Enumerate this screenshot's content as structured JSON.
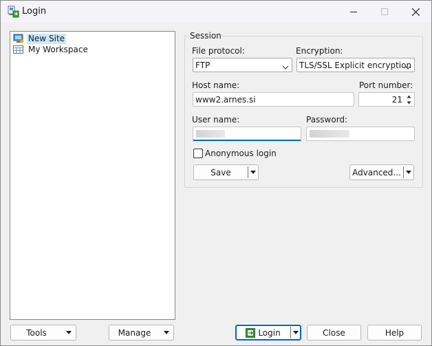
{
  "window": {
    "title": "Login"
  },
  "tree": {
    "items": [
      {
        "label": "New Site",
        "icon": "computer-icon",
        "selected": true
      },
      {
        "label": "My Workspace",
        "icon": "workspace-icon",
        "selected": false
      }
    ]
  },
  "session": {
    "legend": "Session",
    "file_protocol": {
      "label": "File protocol:",
      "value": "FTP"
    },
    "encryption": {
      "label": "Encryption:",
      "value": "TLS/SSL Explicit encryption"
    },
    "host": {
      "label": "Host name:",
      "value": "www2.arnes.si"
    },
    "port": {
      "label": "Port number:",
      "value": "21"
    },
    "user": {
      "label": "User name:",
      "value": ""
    },
    "password": {
      "label": "Password:",
      "value": ""
    },
    "anonymous": {
      "label": "Anonymous login",
      "checked": false
    },
    "save_label": "Save",
    "advanced_label": "Advanced..."
  },
  "footer": {
    "tools_label": "Tools",
    "manage_label": "Manage",
    "login_label": "Login",
    "close_label": "Close",
    "help_label": "Help"
  },
  "colors": {
    "accent": "#0067c0",
    "selection": "#cde8ff",
    "login_icon": "#3aa13a"
  }
}
